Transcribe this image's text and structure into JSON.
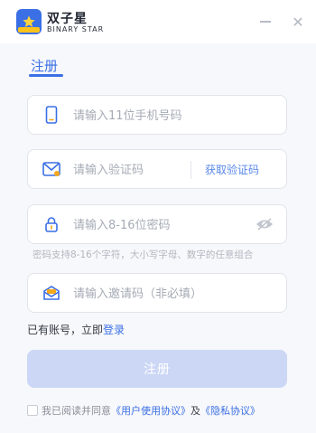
{
  "app": {
    "name_cn": "双子星",
    "name_en": "BINARY STAR"
  },
  "window": {
    "minimize_symbol": "—",
    "close_symbol": "✕"
  },
  "tab": {
    "label": "注册"
  },
  "fields": {
    "phone": {
      "placeholder": "请输入11位手机号码",
      "icon": "phone-icon"
    },
    "code": {
      "placeholder": "请输入验证码",
      "icon": "message-icon",
      "action_label": "获取验证码"
    },
    "password": {
      "placeholder": "请输入8-16位密码",
      "icon": "lock-icon",
      "toggle_icon": "eye-icon"
    },
    "invite": {
      "placeholder": "请输入邀请码（非必填）",
      "icon": "envelope-icon"
    }
  },
  "password_hint": "密码支持8-16个字符，大小写字母、数字的任意组合",
  "login_prompt": {
    "text": "已有账号，立即",
    "link": "登录"
  },
  "submit_label": "注册",
  "agreement": {
    "prefix": "我已阅读并同意",
    "user_agreement": "《用户使用协议》",
    "and": "及",
    "privacy": "《隐私协议》"
  },
  "colors": {
    "accent": "#3a6fe5",
    "submit_disabled": "#ccd7f6",
    "logo_badge": "#ffc21a"
  }
}
